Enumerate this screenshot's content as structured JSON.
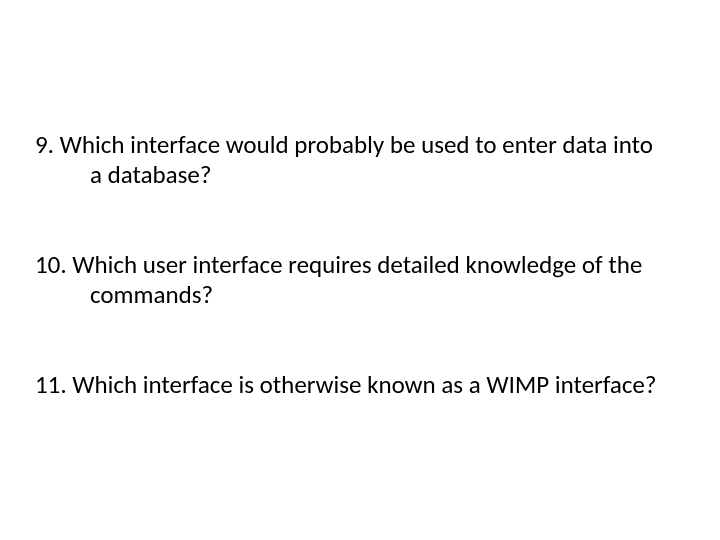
{
  "questions": [
    {
      "number": "9.",
      "text": " Which interface would probably be used to enter data into a database?"
    },
    {
      "number": "10.",
      "text": " Which user interface requires detailed knowledge of the commands?"
    },
    {
      "number": "11.",
      "text": " Which interface is otherwise known as a WIMP interface?"
    }
  ]
}
